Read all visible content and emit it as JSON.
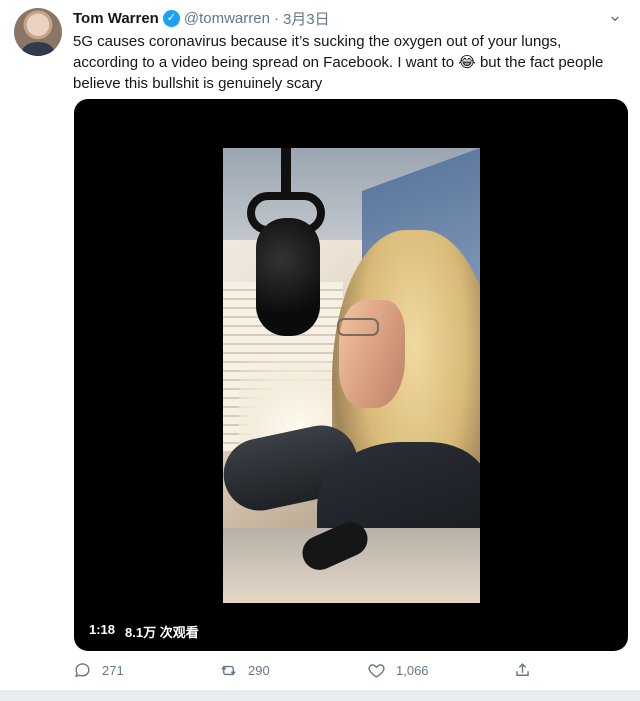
{
  "tweet": {
    "author_name": "Tom Warren",
    "handle": "@tomwarren",
    "separator": "·",
    "date": "3月3日",
    "text_part1": "5G causes coronavirus because it’s sucking the oxygen out of your lungs, according to a video being spread on Facebook. I want to ",
    "emoji": "😂",
    "text_part2": " but the fact people believe this bullshit is genuinely scary",
    "verified_mark": "✓",
    "more_icon": "⌄"
  },
  "video": {
    "duration": "1:18",
    "views": "8.1万 次观看"
  },
  "actions": {
    "reply_count": "271",
    "retweet_count": "290",
    "like_count": "1,066"
  },
  "colors": {
    "text": "#14171a",
    "muted": "#657786",
    "verified": "#1da1f2",
    "media_bg": "#000000"
  },
  "icons": {
    "reply": "reply-icon",
    "retweet": "retweet-icon",
    "like": "heart-icon",
    "share": "share-icon"
  }
}
